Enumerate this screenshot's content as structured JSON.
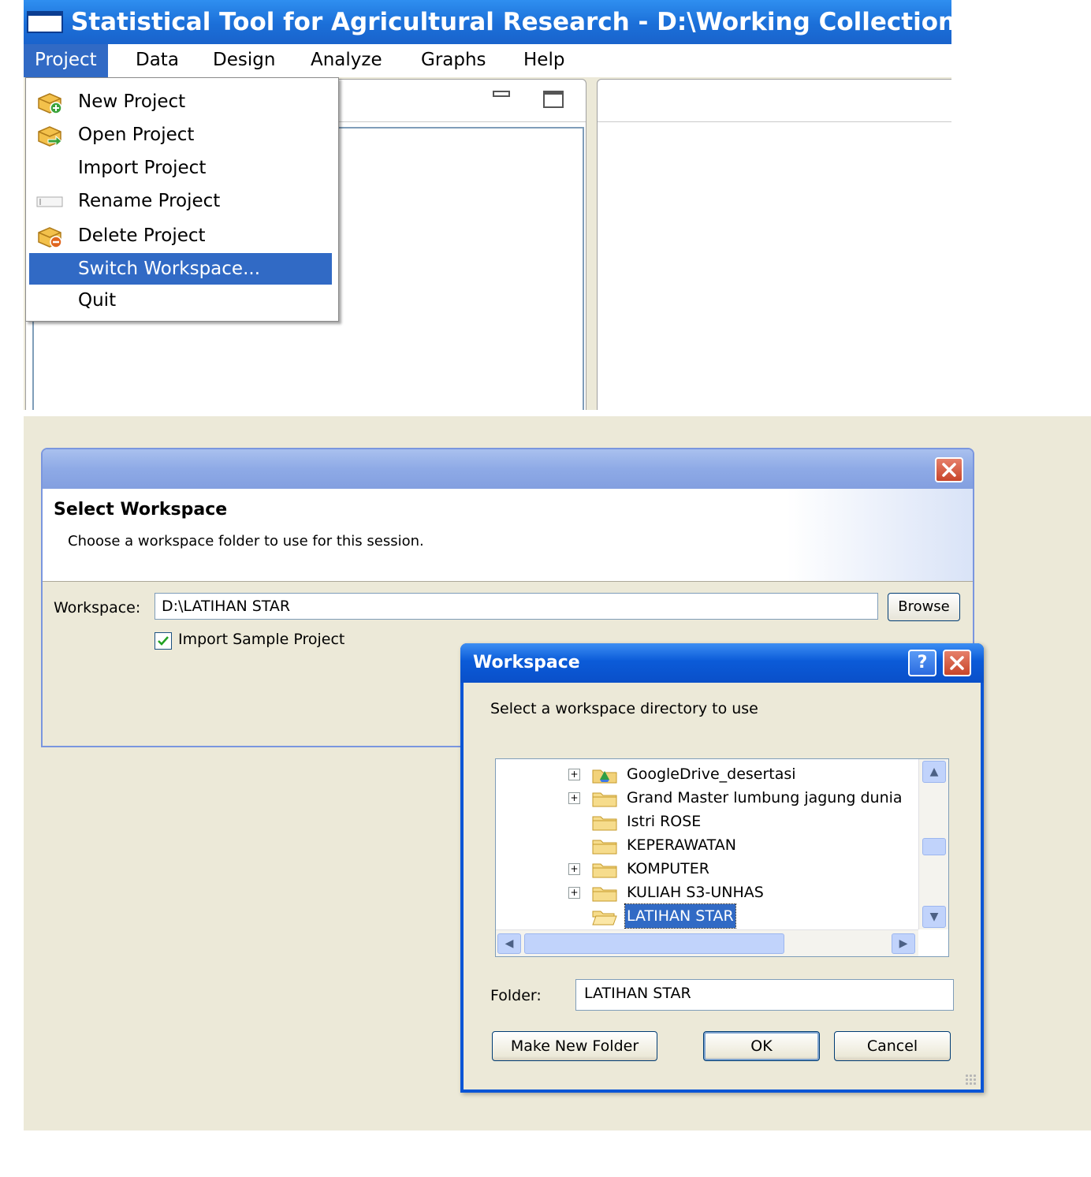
{
  "app": {
    "title": "Statistical Tool for Agricultural Research - D:\\Working Collection",
    "menubar": [
      "Project",
      "Data",
      "Design",
      "Analyze",
      "Graphs",
      "Help"
    ],
    "active_menu": "Project",
    "project_menu": {
      "items": [
        {
          "label": "New Project",
          "icon": "project-new-icon"
        },
        {
          "label": "Open Project",
          "icon": "project-open-icon"
        },
        {
          "label": "Import Project",
          "icon": ""
        },
        {
          "label": "Rename Project",
          "icon": "rename-icon"
        },
        {
          "label": "Delete Project",
          "icon": "project-delete-icon"
        },
        {
          "label": "Switch Workspace...",
          "icon": "",
          "selected": true
        },
        {
          "label": "Quit",
          "icon": ""
        }
      ]
    }
  },
  "select_workspace_dialog": {
    "heading": "Select Workspace",
    "description": "Choose a workspace folder to use for this session.",
    "workspace_label": "Workspace:",
    "workspace_value": "D:\\LATIHAN STAR",
    "browse_label": "Browse",
    "import_sample_label": "Import Sample Project",
    "import_sample_checked": true
  },
  "workspace_browser": {
    "title": "Workspace",
    "help_label": "?",
    "instruction": "Select a workspace directory to use",
    "folders": [
      {
        "label": "GoogleDrive_desertasi",
        "expandable": true,
        "icon": "google-drive-folder-icon"
      },
      {
        "label": "Grand Master lumbung jagung dunia",
        "expandable": true,
        "icon": "folder-icon"
      },
      {
        "label": "Istri ROSE",
        "expandable": false,
        "icon": "folder-icon"
      },
      {
        "label": "KEPERAWATAN",
        "expandable": false,
        "icon": "folder-icon"
      },
      {
        "label": "KOMPUTER",
        "expandable": true,
        "icon": "folder-icon"
      },
      {
        "label": "KULIAH S3-UNHAS",
        "expandable": true,
        "icon": "folder-icon"
      },
      {
        "label": "LATIHAN STAR",
        "expandable": false,
        "icon": "folder-open-icon",
        "selected": true
      }
    ],
    "folder_label": "Folder:",
    "folder_value": "LATIHAN STAR",
    "make_new_folder_label": "Make New Folder",
    "ok_label": "OK",
    "cancel_label": "Cancel"
  },
  "colors": {
    "xp_title_blue": "#0a55d6",
    "menu_highlight": "#316ac5",
    "dialog_face": "#ece9d8"
  }
}
